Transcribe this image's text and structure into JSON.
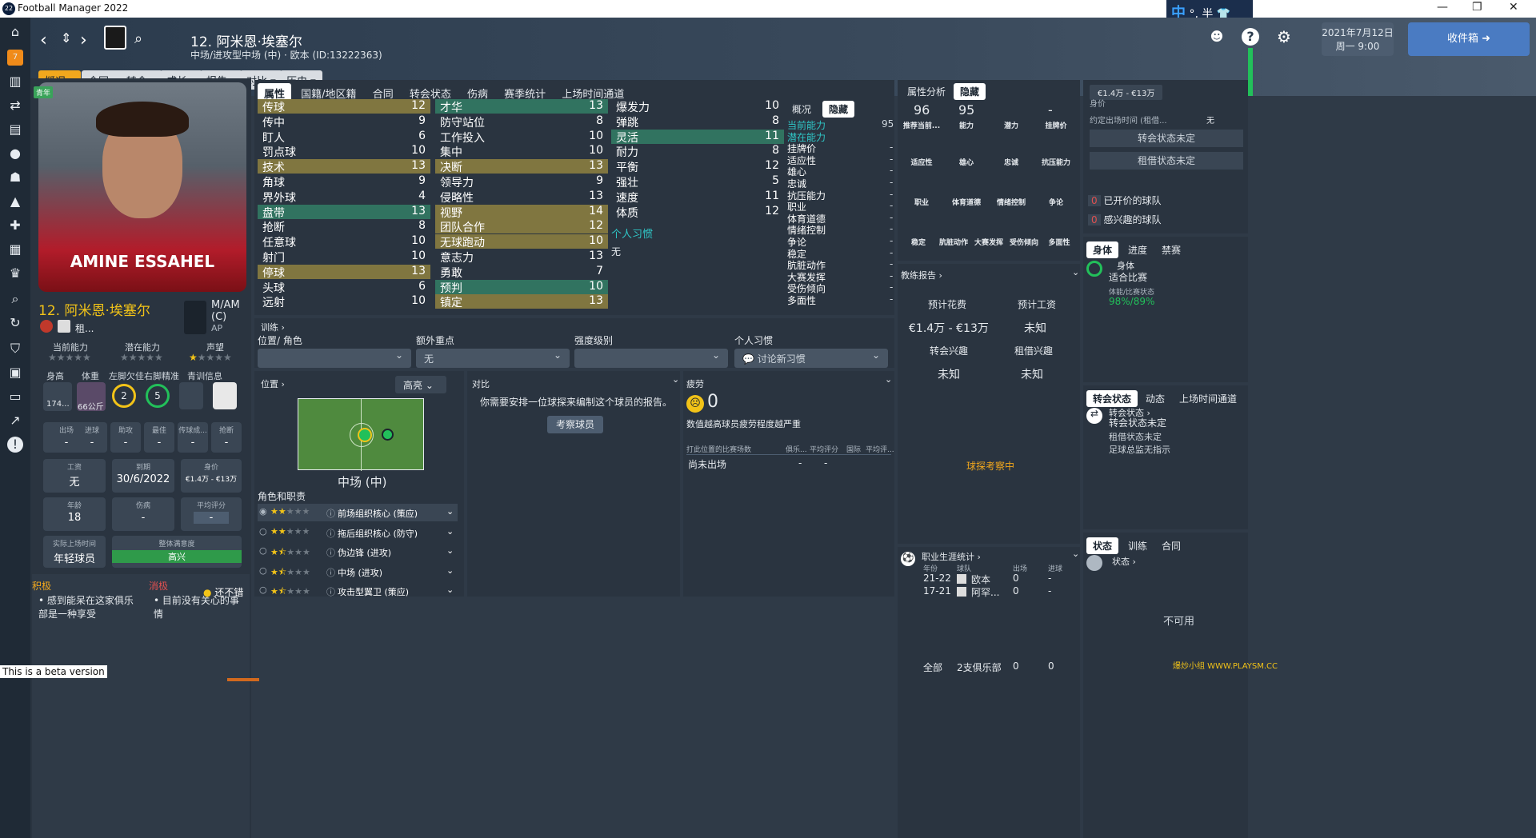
{
  "window": {
    "title": "Football Manager 2022",
    "app_icon": "22"
  },
  "ime": {
    "label": "中",
    "mode": "°, 半"
  },
  "header": {
    "player_title": "12. 阿米恩·埃塞尔",
    "player_info": "中场/进攻型中场 (中) · 欧本 (ID:13222363)",
    "date_line1": "2021年7月12日",
    "date_line2": "周一 9:00",
    "inbox_label": "收件箱"
  },
  "toolbar": [
    "概况",
    "合同",
    "转会",
    "成长",
    "报告",
    "对比",
    "历史"
  ],
  "profile": {
    "badge": "青年",
    "name": "12. 阿米恩·埃塞尔",
    "shirt_text": "AMINE ESSAHEL",
    "positions": "M/AM (C)",
    "position_sub": "AP",
    "loan": "租...",
    "ratings_labels": [
      "当前能力",
      "潜在能力",
      "声望"
    ],
    "labels_row": [
      "身高",
      "体重",
      "左脚欠佳",
      "右脚精准",
      "青训信息"
    ],
    "height": "174...",
    "weight": "66公斤",
    "left_foot": "2",
    "right_foot": "5",
    "stats": [
      {
        "a": "出场",
        "b": "-"
      },
      {
        "a": "进球",
        "b": "-"
      },
      {
        "a": "助攻",
        "b": "-"
      },
      {
        "a": "最佳",
        "b": "-"
      },
      {
        "a": "传球成...",
        "b": "-"
      },
      {
        "a": "抢断",
        "b": "-"
      }
    ],
    "wage_label": "工资",
    "wage": "无",
    "expiry_label": "到期",
    "expiry": "30/6/2022",
    "value_label": "身价",
    "value": "€1.4万 - €13万",
    "age_label": "年龄",
    "age": "18",
    "injury_label": "伤病",
    "injury": "-",
    "avg_label": "平均评分",
    "avg": "-",
    "playtime_label": "实际上场时间",
    "playtime": "年轻球员",
    "morale_label": "整体满意度",
    "morale": "高兴",
    "pos_title": "积极",
    "neg_title": "消极",
    "pos_item": "感到能呆在这家俱乐部是一种享受",
    "neg_item": "目前没有关心的事情",
    "mood_tag": "还不错"
  },
  "attr_tabs": [
    "属性",
    "国籍/地区籍",
    "合同",
    "转会状态",
    "伤病",
    "赛季统计",
    "上场时间通道"
  ],
  "attrs_col1": [
    [
      "传球",
      "12"
    ],
    [
      "传中",
      "9"
    ],
    [
      "盯人",
      "6"
    ],
    [
      "罚点球",
      "10"
    ],
    [
      "技术",
      "13"
    ],
    [
      "角球",
      "9"
    ],
    [
      "界外球",
      "4"
    ],
    [
      "盘带",
      "13"
    ],
    [
      "抢断",
      "8"
    ],
    [
      "任意球",
      "10"
    ],
    [
      "射门",
      "10"
    ],
    [
      "停球",
      "13"
    ],
    [
      "头球",
      "6"
    ],
    [
      "远射",
      "10"
    ]
  ],
  "attrs_col2": [
    [
      "才华",
      "13"
    ],
    [
      "防守站位",
      "8"
    ],
    [
      "工作投入",
      "10"
    ],
    [
      "集中",
      "10"
    ],
    [
      "决断",
      "13"
    ],
    [
      "领导力",
      "9"
    ],
    [
      "侵略性",
      "13"
    ],
    [
      "视野",
      "14"
    ],
    [
      "团队合作",
      "12"
    ],
    [
      "无球跑动",
      "10"
    ],
    [
      "意志力",
      "13"
    ],
    [
      "勇敢",
      "7"
    ],
    [
      "预判",
      "10"
    ],
    [
      "镇定",
      "13"
    ]
  ],
  "attrs_col3": [
    [
      "爆发力",
      "10"
    ],
    [
      "弹跳",
      "8"
    ],
    [
      "灵活",
      "11"
    ],
    [
      "耐力",
      "8"
    ],
    [
      "平衡",
      "12"
    ],
    [
      "强壮",
      "5"
    ],
    [
      "速度",
      "11"
    ],
    [
      "体质",
      "12"
    ]
  ],
  "habits_title": "个人习惯",
  "habits_value": "无",
  "hidden_tabs": [
    "概况",
    "隐藏"
  ],
  "hidden_list": [
    [
      "当前能力",
      "95"
    ],
    [
      "潜在能力",
      ""
    ],
    [
      "挂牌价",
      "-"
    ],
    [
      "适应性",
      "-"
    ],
    [
      "雄心",
      "-"
    ],
    [
      "忠诚",
      "-"
    ],
    [
      "抗压能力",
      "-"
    ],
    [
      "职业",
      "-"
    ],
    [
      "体育道德",
      "-"
    ],
    [
      "情绪控制",
      "-"
    ],
    [
      "争论",
      "-"
    ],
    [
      "稳定",
      "-"
    ],
    [
      "肮脏动作",
      "-"
    ],
    [
      "大赛发挥",
      "-"
    ],
    [
      "受伤倾向",
      "-"
    ],
    [
      "多面性",
      "-"
    ]
  ],
  "training": {
    "title": "训练",
    "labels": [
      "位置/ 角色",
      "额外重点",
      "强度级别",
      "个人习惯"
    ],
    "values": [
      "",
      "无",
      "",
      "讨论新习惯"
    ]
  },
  "position": {
    "title": "位置",
    "mode": "高亮",
    "name": "中场 (中)",
    "roles_title": "角色和职责",
    "roles": [
      "前场组织核心 (策应)",
      "拖后组织核心 (防守)",
      "伪边锋 (进攻)",
      "中场 (进攻)",
      "攻击型翼卫 (策应)"
    ]
  },
  "compare": {
    "title": "对比",
    "text": "你需要安排一位球探来编制这个球员的报告。",
    "button": "考察球员"
  },
  "fatigue": {
    "title": "疲劳",
    "value": "0",
    "desc": "数值越高球员疲劳程度越严重",
    "cols": [
      "打此位置的比赛场数",
      "俱乐...",
      "平均评分",
      "国际",
      "平均评..."
    ],
    "row": [
      "尚未出场",
      "-",
      "-"
    ]
  },
  "analysis": {
    "tabs": [
      "属性分析",
      "隐藏"
    ],
    "nums": [
      "96",
      "95",
      "",
      "-"
    ],
    "labels": [
      "推荐当前...",
      "能力",
      "潜力",
      "挂牌价"
    ],
    "row2": [
      "适应性",
      "雄心",
      "忠诚",
      "抗压能力"
    ],
    "row3": [
      "职业",
      "体育道德",
      "情绪控制",
      "争论"
    ],
    "row4": [
      "稳定",
      "肮脏动作",
      "大赛发挥",
      "受伤倾向",
      "多面性"
    ]
  },
  "report": {
    "title": "教练报告",
    "labels": [
      "预计花费",
      "预计工资",
      "转会兴趣",
      "租借兴趣"
    ],
    "values": [
      "€1.4万 - €13万",
      "未知",
      "未知",
      "未知"
    ],
    "scouting": "球探考察中"
  },
  "career": {
    "title": "职业生涯统计",
    "cols": [
      "年份",
      "球队",
      "出场",
      "进球"
    ],
    "rows": [
      [
        "21-22",
        "欧本",
        "0",
        "-"
      ],
      [
        "17-21",
        "阿罕...",
        "0",
        "-"
      ]
    ],
    "total": [
      "全部",
      "2支俱乐部",
      "0",
      "0"
    ]
  },
  "right": {
    "value_badge": "€1.4万 - €13万",
    "value_label": "身价",
    "fee_label": "约定出场时间 (租借...",
    "fee": "无",
    "s1": "转会状态未定",
    "s2": "租借状态未定",
    "teams_open": "已开价的球队",
    "teams_open_n": "0",
    "teams_int": "感兴趣的球队",
    "teams_int_n": "0",
    "body_tabs": [
      "身体",
      "进度",
      "禁赛"
    ],
    "body_title": "身体",
    "body_state": "适合比赛",
    "cond_label": "体能/比赛状态",
    "cond": "98%/89%",
    "tr_tabs": [
      "转会状态",
      "动态",
      "上场时间通道"
    ],
    "tr_title": "转会状态",
    "tr_line1": "转会状态未定",
    "tr_line2": "租借状态未定",
    "tr_line3": "足球总监无指示",
    "st_tabs": [
      "状态",
      "训练",
      "合同"
    ],
    "st_title": "状态",
    "unavailable": "不可用"
  },
  "beta": "This is a beta version",
  "watermark": "爆炒小组 WWW.PLAYSM.CC"
}
